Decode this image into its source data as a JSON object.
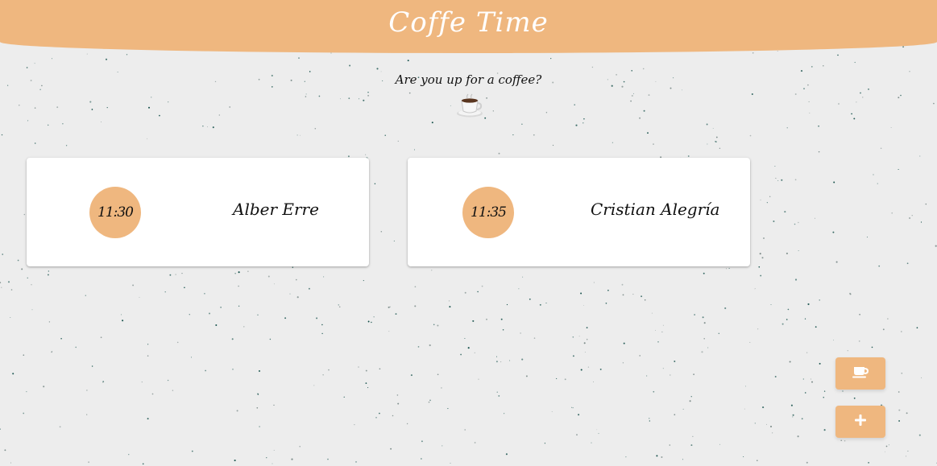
{
  "header": {
    "title": "Coffe Time"
  },
  "intro": {
    "question": "Are you up for a coffee?",
    "icon": "coffee-cup-icon"
  },
  "cards": [
    {
      "time": "11:30",
      "name": "Alber Erre"
    },
    {
      "time": "11:35",
      "name": "Cristian Alegría"
    }
  ],
  "actions": {
    "coffee_button_icon": "coffee-cup-icon",
    "add_button_icon": "plus-icon"
  },
  "colors": {
    "accent": "#efb77f",
    "background": "#ededed",
    "speckle": "#0d4a44",
    "card": "#ffffff",
    "text": "#111111"
  }
}
